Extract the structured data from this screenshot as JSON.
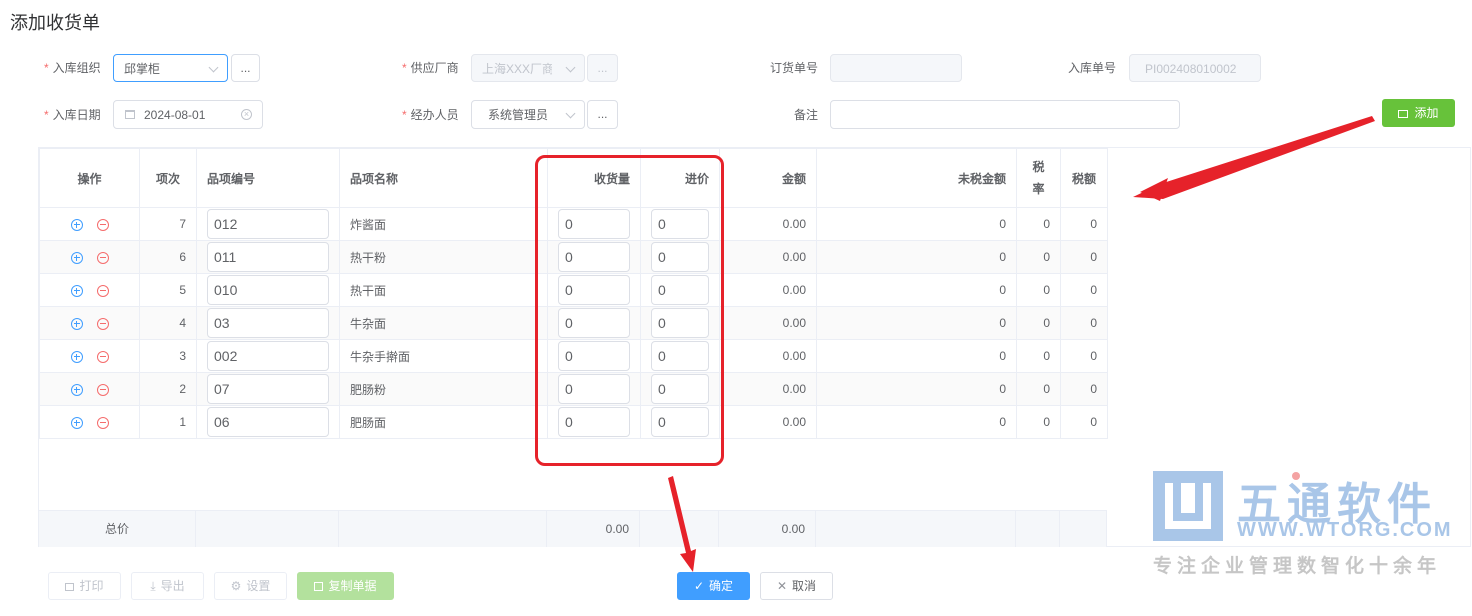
{
  "page_title": "添加收货单",
  "form": {
    "org_label": "入库组织",
    "org_value": "邱掌柜",
    "supplier_label": "供应厂商",
    "supplier_value": "上海XXX厂商",
    "order_no_label": "订货单号",
    "order_no_value": "",
    "receipt_no_label": "入库单号",
    "receipt_no_value": "PI002408010002",
    "date_label": "入库日期",
    "date_value": "2024-08-01",
    "handler_label": "经办人员",
    "handler_value": "系统管理员",
    "remark_label": "备注",
    "remark_value": "",
    "dots": "...",
    "add_button": "添加"
  },
  "table": {
    "headers": {
      "op": "操作",
      "idx": "项次",
      "code": "品项编号",
      "name": "品项名称",
      "qty": "收货量",
      "price": "进价",
      "amount": "金额",
      "pretax": "未税金额",
      "taxrate_1": "税",
      "taxrate_2": "率",
      "tax": "税额"
    },
    "rows": [
      {
        "idx": "7",
        "code": "012",
        "name": "炸酱面",
        "qty": "0",
        "price": "0",
        "amount": "0.00",
        "pretax": "0",
        "rate": "0",
        "tax": "0"
      },
      {
        "idx": "6",
        "code": "011",
        "name": "热干粉",
        "qty": "0",
        "price": "0",
        "amount": "0.00",
        "pretax": "0",
        "rate": "0",
        "tax": "0"
      },
      {
        "idx": "5",
        "code": "010",
        "name": "热干面",
        "qty": "0",
        "price": "0",
        "amount": "0.00",
        "pretax": "0",
        "rate": "0",
        "tax": "0"
      },
      {
        "idx": "4",
        "code": "03",
        "name": "牛杂面",
        "qty": "0",
        "price": "0",
        "amount": "0.00",
        "pretax": "0",
        "rate": "0",
        "tax": "0"
      },
      {
        "idx": "3",
        "code": "002",
        "name": "牛杂手擀面",
        "qty": "0",
        "price": "0",
        "amount": "0.00",
        "pretax": "0",
        "rate": "0",
        "tax": "0"
      },
      {
        "idx": "2",
        "code": "07",
        "name": "肥肠粉",
        "qty": "0",
        "price": "0",
        "amount": "0.00",
        "pretax": "0",
        "rate": "0",
        "tax": "0"
      },
      {
        "idx": "1",
        "code": "06",
        "name": "肥肠面",
        "qty": "0",
        "price": "0",
        "amount": "0.00",
        "pretax": "0",
        "rate": "0",
        "tax": "0"
      }
    ],
    "footer": {
      "label": "总价",
      "qty_total": "0.00",
      "amount_total": "0.00"
    }
  },
  "buttons": {
    "print": "打印",
    "export": "导出",
    "settings": "设置",
    "copy": "复制单据",
    "confirm": "确定",
    "cancel": "取消"
  },
  "watermark": {
    "name": "五通软件",
    "url": "WWW.WTORG.COM",
    "slogan": "专注企业管理数智化十余年"
  },
  "colors": {
    "primary": "#409eff",
    "success": "#67c23a",
    "danger": "#f56c6c",
    "highlight": "#e6222a"
  }
}
